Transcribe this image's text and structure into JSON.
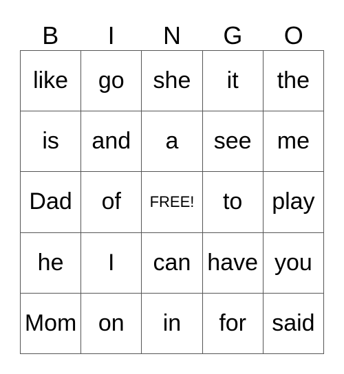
{
  "header": [
    "B",
    "I",
    "N",
    "G",
    "O"
  ],
  "rows": [
    [
      "like",
      "go",
      "she",
      "it",
      "the"
    ],
    [
      "is",
      "and",
      "a",
      "see",
      "me"
    ],
    [
      "Dad",
      "of",
      "FREE!",
      "to",
      "play"
    ],
    [
      "he",
      "I",
      "can",
      "have",
      "you"
    ],
    [
      "Mom",
      "on",
      "in",
      "for",
      "said"
    ]
  ]
}
